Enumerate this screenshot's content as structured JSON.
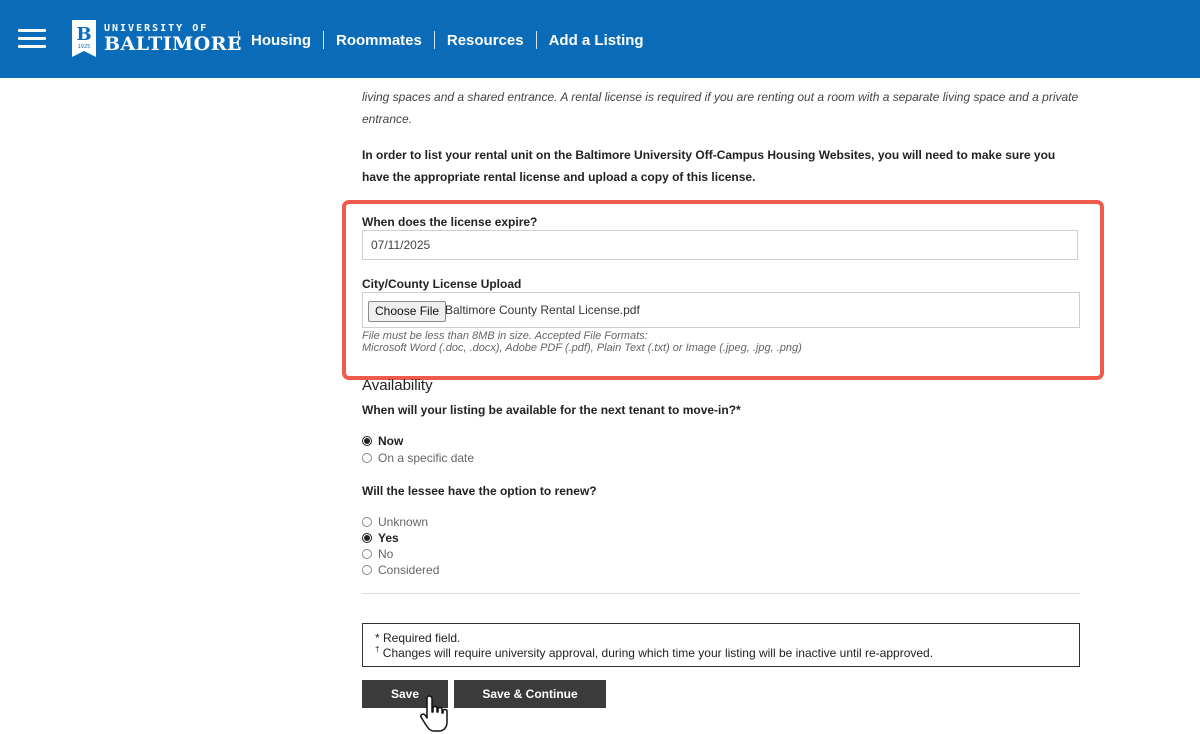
{
  "header": {
    "logo": {
      "small": "UNIVERSITY OF",
      "big": "BALTIMORE",
      "mark_letter": "B",
      "mark_year": "1925"
    },
    "nav": [
      {
        "label": "Housing"
      },
      {
        "label": "Roommates"
      },
      {
        "label": "Resources"
      },
      {
        "label": "Add a Listing"
      }
    ],
    "brand_color": "#0a6cb8"
  },
  "intro": {
    "italic_text": "living spaces and a shared entrance. A rental license is required if you are renting out a room with a separate living space and a private entrance.",
    "bold_text": "In order to list your rental unit on the Baltimore University Off-Campus Housing Websites, you will need to make sure you have the appropriate rental license and upload a copy of this license."
  },
  "license": {
    "expire_label": "When does the license expire?",
    "expire_value": "07/11/2025",
    "upload_label": "City/County License Upload",
    "choose_file_label": "Choose File",
    "file_name": "Baltimore County Rental License.pdf",
    "help_line1": "File must be less than 8MB in size. Accepted File Formats:",
    "help_line2": "Microsoft Word (.doc, .docx), Adobe PDF (.pdf), Plain Text (.txt) or Image (.jpeg, .jpg, .png)",
    "highlight_color": "#f05a4a"
  },
  "availability": {
    "title": "Availability",
    "question": "When will your listing be available for the next tenant to move-in?*",
    "options": [
      {
        "label": "Now",
        "checked": true
      },
      {
        "label": "On a specific date",
        "checked": false
      }
    ]
  },
  "renew": {
    "question": "Will the lessee have the option to renew?",
    "options": [
      {
        "label": "Unknown",
        "checked": false
      },
      {
        "label": "Yes",
        "checked": true
      },
      {
        "label": "No",
        "checked": false
      },
      {
        "label": "Considered",
        "checked": false
      }
    ]
  },
  "notes": {
    "required": "* Required field.",
    "dagger": "†",
    "changes": " Changes will require university approval, during which time your listing will be inactive until re-approved."
  },
  "buttons": {
    "save": "Save",
    "save_continue": "Save & Continue"
  }
}
